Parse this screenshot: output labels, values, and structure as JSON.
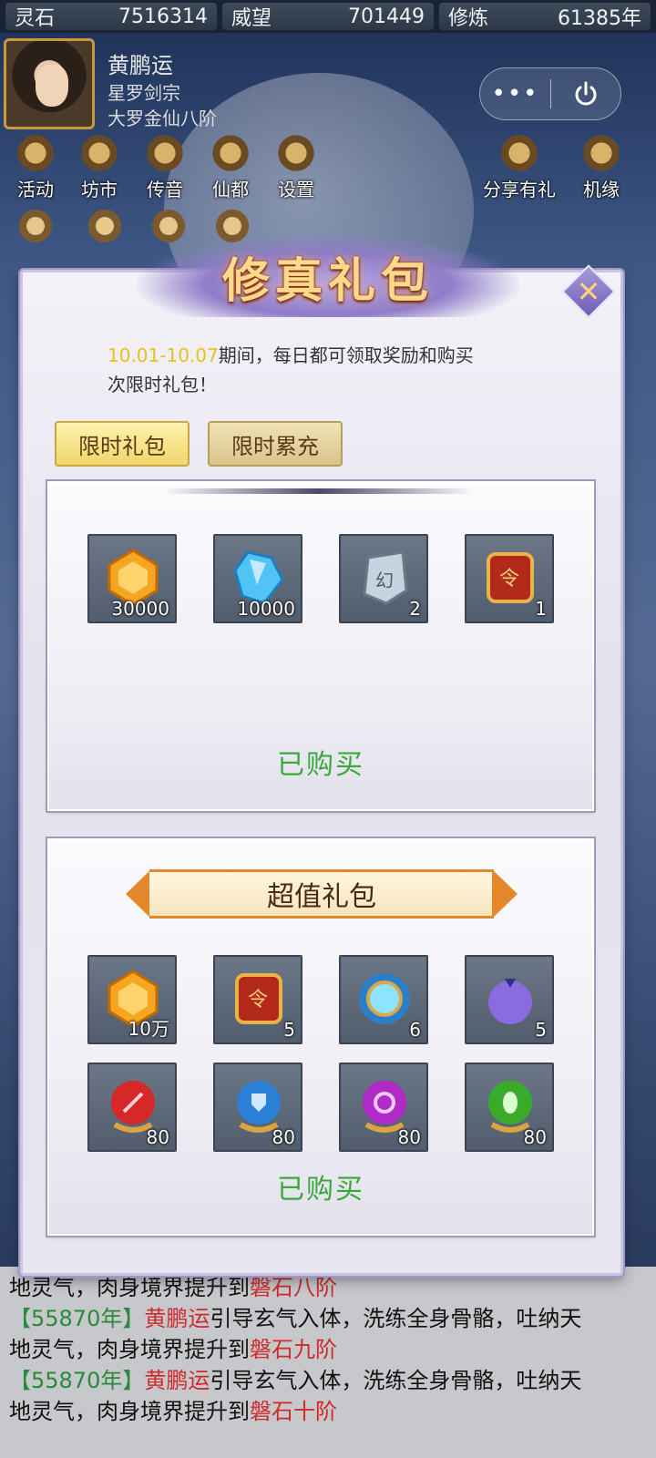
{
  "resources": [
    {
      "name": "灵石",
      "value": "7516314"
    },
    {
      "name": "威望",
      "value": "701449"
    },
    {
      "name": "修炼",
      "value": "61385年"
    }
  ],
  "player": {
    "name": "黄鹏运",
    "sect": "星罗剑宗",
    "rank": "大罗金仙八阶"
  },
  "capsule": {
    "more": "•••"
  },
  "menu": [
    "活动",
    "坊市",
    "传音",
    "仙都",
    "设置"
  ],
  "side_menu": [
    "分享有礼",
    "机缘"
  ],
  "modal": {
    "title": "修真礼包",
    "close": "✕",
    "notice_date": "10.01-10.07",
    "notice_text1": "期间，每日都可领取奖励和购买",
    "notice_text2": "次限时礼包！",
    "tabs": [
      "限时礼包",
      "限时累充"
    ],
    "panel1": {
      "items": [
        {
          "icon": "gold-gem-icon",
          "count": "30000"
        },
        {
          "icon": "blue-crystal-icon",
          "count": "10000"
        },
        {
          "icon": "jade-token-icon",
          "count": "2"
        },
        {
          "icon": "red-order-token-icon",
          "count": "1"
        }
      ],
      "status": "已购买"
    },
    "panel2": {
      "title": "超值礼包",
      "items": [
        {
          "icon": "gold-gem-icon",
          "count": "10万"
        },
        {
          "icon": "red-order-token-icon",
          "count": "5"
        },
        {
          "icon": "spirit-orb-icon",
          "count": "6"
        },
        {
          "icon": "purple-fruit-icon",
          "count": "5"
        },
        {
          "icon": "red-sword-orb-icon",
          "count": "80"
        },
        {
          "icon": "blue-shield-orb-icon",
          "count": "80"
        },
        {
          "icon": "purple-vortex-orb-icon",
          "count": "80"
        },
        {
          "icon": "green-leaf-orb-icon",
          "count": "80"
        }
      ],
      "status": "已购买"
    }
  },
  "log": [
    {
      "pre": "地灵气，肉身境界提升到",
      "hl": "磐石八阶"
    },
    {
      "year": "【55870年】",
      "name": "黄鹏运",
      "text": "引导玄气入体，洗练全身骨骼，吐纳天"
    },
    {
      "pre": "地灵气，肉身境界提升到",
      "hl": "磐石九阶"
    },
    {
      "year": "【55870年】",
      "name": "黄鹏运",
      "text": "引导玄气入体，洗练全身骨骼，吐纳天"
    },
    {
      "pre": "地灵气，肉身境界提升到",
      "hl": "磐石十阶"
    }
  ],
  "colors": {
    "accent_gold": "#ffd98a",
    "status_green": "#3aa83a",
    "log_year": "#2a8a3a",
    "log_name": "#d02a2a"
  }
}
